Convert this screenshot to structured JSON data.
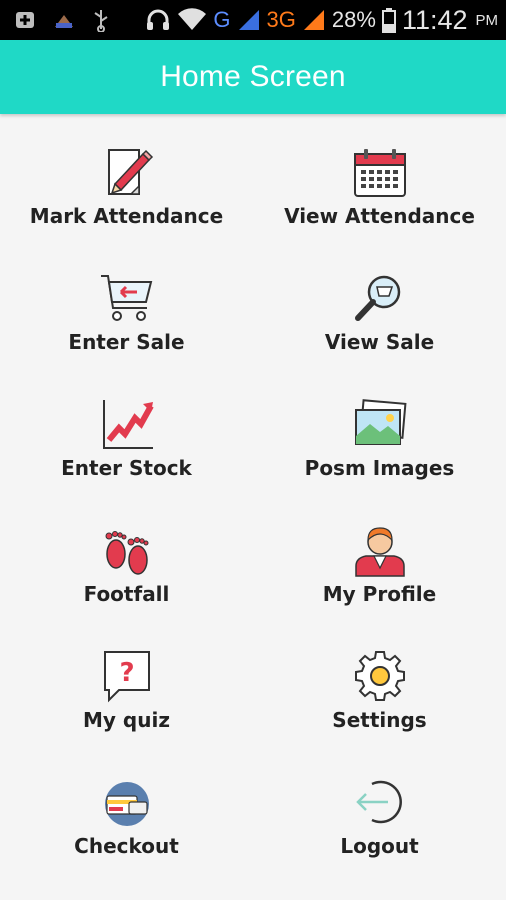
{
  "status_bar": {
    "network_g": "G",
    "network_3g": "3G",
    "battery": "28%",
    "time": "11:42",
    "ampm": "PM"
  },
  "app_bar": {
    "title": "Home Screen"
  },
  "menu": {
    "items": [
      {
        "label": "Mark Attendance",
        "icon": "pencil-paper-icon"
      },
      {
        "label": "View Attendance",
        "icon": "calendar-icon"
      },
      {
        "label": "Enter Sale",
        "icon": "shopping-cart-icon"
      },
      {
        "label": "View Sale",
        "icon": "magnifier-cart-icon"
      },
      {
        "label": "Enter Stock",
        "icon": "rising-chart-icon"
      },
      {
        "label": "Posm Images",
        "icon": "image-gallery-icon"
      },
      {
        "label": "Footfall",
        "icon": "footprints-icon"
      },
      {
        "label": "My Profile",
        "icon": "profile-avatar-icon"
      },
      {
        "label": "My quiz",
        "icon": "question-bubble-icon"
      },
      {
        "label": "Settings",
        "icon": "gear-icon"
      },
      {
        "label": "Checkout",
        "icon": "checkout-card-icon"
      },
      {
        "label": "Logout",
        "icon": "logout-icon"
      }
    ]
  },
  "colors": {
    "accent": "#1fd9c6",
    "background": "#f5f5f5"
  }
}
